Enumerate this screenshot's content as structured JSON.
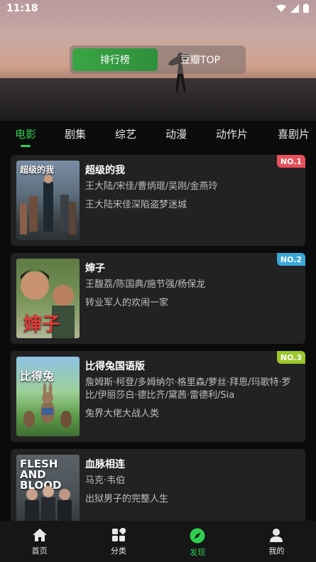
{
  "status": {
    "time": "11:18"
  },
  "segment": {
    "options": [
      "排行榜",
      "豆瓣TOP"
    ],
    "selected": "排行榜"
  },
  "categories": [
    "电影",
    "剧集",
    "综艺",
    "动漫",
    "动作片",
    "喜剧片"
  ],
  "movies": [
    {
      "rank": "NO.1",
      "rank_color": "#e8505b",
      "title": "超级的我",
      "poster_text": "超级的我",
      "cast": "王大陆/宋佳/曹炳琨/吴刚/金燕玲",
      "desc": "王大陆宋佳深陷盗梦迷城"
    },
    {
      "rank": "NO.2",
      "rank_color": "#3aa8d8",
      "title": "婶子",
      "poster_text": "婶子",
      "cast": "王馥荔/陈国典/施节强/杨保龙",
      "desc": "转业军人的欢闹一家"
    },
    {
      "rank": "NO.3",
      "rank_color": "#9bc72c",
      "title": "比得兔国语版",
      "poster_text": "比得兔",
      "cast": "詹姆斯·柯登/多姆纳尔·格里森/萝丝·拜恩/玛歌特·罗比/伊丽莎白·德比齐/黛茜·雷德利/Sia",
      "desc": "兔界大佬大战人类"
    },
    {
      "rank": "",
      "rank_color": "",
      "title": "血脉相连",
      "poster_text": "FLESH AND BLOOD",
      "cast": "马克·韦伯",
      "desc": "出狱男子的完整人生"
    }
  ],
  "nav": [
    {
      "label": "首页",
      "icon": "home-icon"
    },
    {
      "label": "分类",
      "icon": "category-icon"
    },
    {
      "label": "发现",
      "icon": "compass-icon"
    },
    {
      "label": "我的",
      "icon": "person-icon"
    }
  ],
  "accent_color": "#2fcf4f"
}
